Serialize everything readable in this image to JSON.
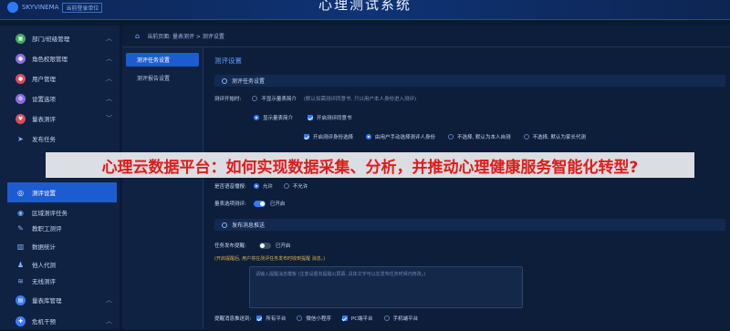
{
  "header": {
    "logo_text": "SKYVINEMA",
    "logo_tag": "当前登录单位",
    "system_title": "心理测试系统"
  },
  "sidebar": {
    "items": [
      {
        "label": "部门/班级管理",
        "icon": "org-icon",
        "color": "#3fae5a",
        "chevron": "︿"
      },
      {
        "label": "角色权限管理",
        "icon": "role-icon",
        "color": "#8e6be0",
        "chevron": "︿"
      },
      {
        "label": "用户管理",
        "icon": "user-icon",
        "color": "#e04a5a",
        "chevron": "︿"
      },
      {
        "label": "设置选项",
        "icon": "settings-icon",
        "color": "#8e6be0",
        "chevron": "︿"
      },
      {
        "label": "量表测评",
        "icon": "assessment-icon",
        "color": "#e04a5a",
        "chevron": "﹀"
      }
    ],
    "subitems": [
      {
        "label": "发布任务",
        "icon": "send-icon"
      },
      {
        "label": "测评设置",
        "icon": "target-icon"
      },
      {
        "label": "区域测评任务",
        "icon": "region-icon"
      },
      {
        "label": "教职工测评",
        "icon": "staff-icon"
      },
      {
        "label": "数据统计",
        "icon": "chart-icon"
      },
      {
        "label": "他人代测",
        "icon": "proxy-icon"
      },
      {
        "label": "无线测评",
        "icon": "wifi-icon"
      }
    ],
    "bottom_items": [
      {
        "label": "量表库管理",
        "icon": "library-icon",
        "color": "#3b7bff",
        "chevron": "︿"
      },
      {
        "label": "危机干预",
        "icon": "crisis-icon",
        "color": "#3b7bff",
        "chevron": "︿"
      }
    ]
  },
  "breadcrumb": "当前页面: 量表测评 > 测评设置",
  "subnav": [
    "测评任务设置",
    "测评报告设置"
  ],
  "panel": {
    "title": "测评设置",
    "section1": "测评任务设置",
    "start_label": "测评开始时:",
    "opt_no_intro": "不显示量表简介",
    "opt_no_intro_hint": "(默认如需测评同意书, 只以用户本人身份进入测评)",
    "opt_show_intro": "显示量表简介",
    "opt_consent": "开启测评同意书",
    "opt_identity": "开启测评身份选择",
    "opt_manual": "由用户手动选择测评人身份",
    "opt_default_self": "不选择, 默认为本人自测",
    "opt_default_parent": "不选择, 默认为家长代测",
    "voice_label": "是否语音播报:",
    "voice_allow": "允许",
    "voice_deny": "不允许",
    "random_label": "量表选项测评:",
    "random_state": "已开启",
    "section2": "发布消息推送",
    "publish_label": "任务发布提醒:",
    "publish_state": "已开启",
    "publish_warn": "(开启提醒后, 用户将在测评任务发布时收到提醒 消息。)",
    "textarea_placeholder": "请输入提醒消息模板 (注意设置向提醒公屏幕, 具体文字可以在发布任务时候内修改。)",
    "channels_label": "提醒消息推送到:",
    "channels": [
      "所有平台",
      "微信小程序",
      "PC端平台",
      "手机端平台"
    ]
  },
  "overlay_banner": "心理云数据平台：如何实现数据采集、分析，并推动心理健康服务智能化转型?"
}
